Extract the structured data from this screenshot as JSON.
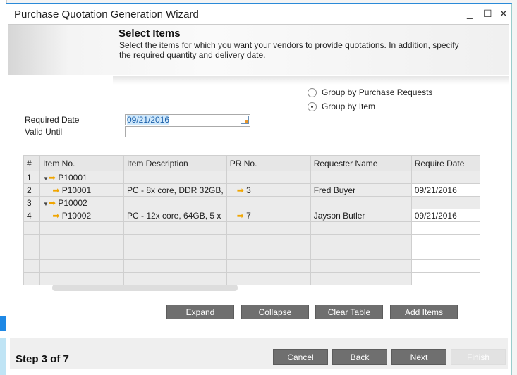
{
  "window": {
    "title": "Purchase Quotation Generation Wizard",
    "minimize": "_",
    "maximize": "☐",
    "close": "✕"
  },
  "header": {
    "title": "Select Items",
    "description": "Select the items for which you want your vendors to provide quotations. In addition, specify the required quantity and delivery date."
  },
  "grouping": {
    "options": [
      "Group by Purchase Requests",
      "Group by Item"
    ],
    "selected": "Group by Item"
  },
  "fields": {
    "required_date_label": "Required Date",
    "required_date_value": "09/21/2016",
    "valid_until_label": "Valid Until",
    "valid_until_value": ""
  },
  "table": {
    "columns": [
      "#",
      "Item No.",
      "Item Description",
      "PR No.",
      "Requester Name",
      "Require Date"
    ],
    "rows": [
      {
        "num": "1",
        "item": "P10001",
        "desc": "",
        "pr": "",
        "requester": "",
        "date": "",
        "group": true
      },
      {
        "num": "2",
        "item": "P10001",
        "desc": "PC - 8x core, DDR 32GB,",
        "pr": "3",
        "requester": "Fred Buyer",
        "date": "09/21/2016",
        "group": false
      },
      {
        "num": "3",
        "item": "P10002",
        "desc": "",
        "pr": "",
        "requester": "",
        "date": "",
        "group": true
      },
      {
        "num": "4",
        "item": "P10002",
        "desc": "PC - 12x core, 64GB, 5 x",
        "pr": "7",
        "requester": "Jayson Butler",
        "date": "09/21/2016",
        "group": false
      }
    ],
    "empty_rows": 5
  },
  "actions": {
    "expand": "Expand",
    "collapse": "Collapse",
    "clear_table": "Clear Table",
    "add_items": "Add Items"
  },
  "footer": {
    "step": "Step 3 of 7",
    "cancel": "Cancel",
    "back": "Back",
    "next": "Next",
    "finish": "Finish",
    "finish_enabled": false
  },
  "colors": {
    "button": "#6f6f6f",
    "accent": "#2a8ad8",
    "link_arrow": "#f0a500"
  }
}
